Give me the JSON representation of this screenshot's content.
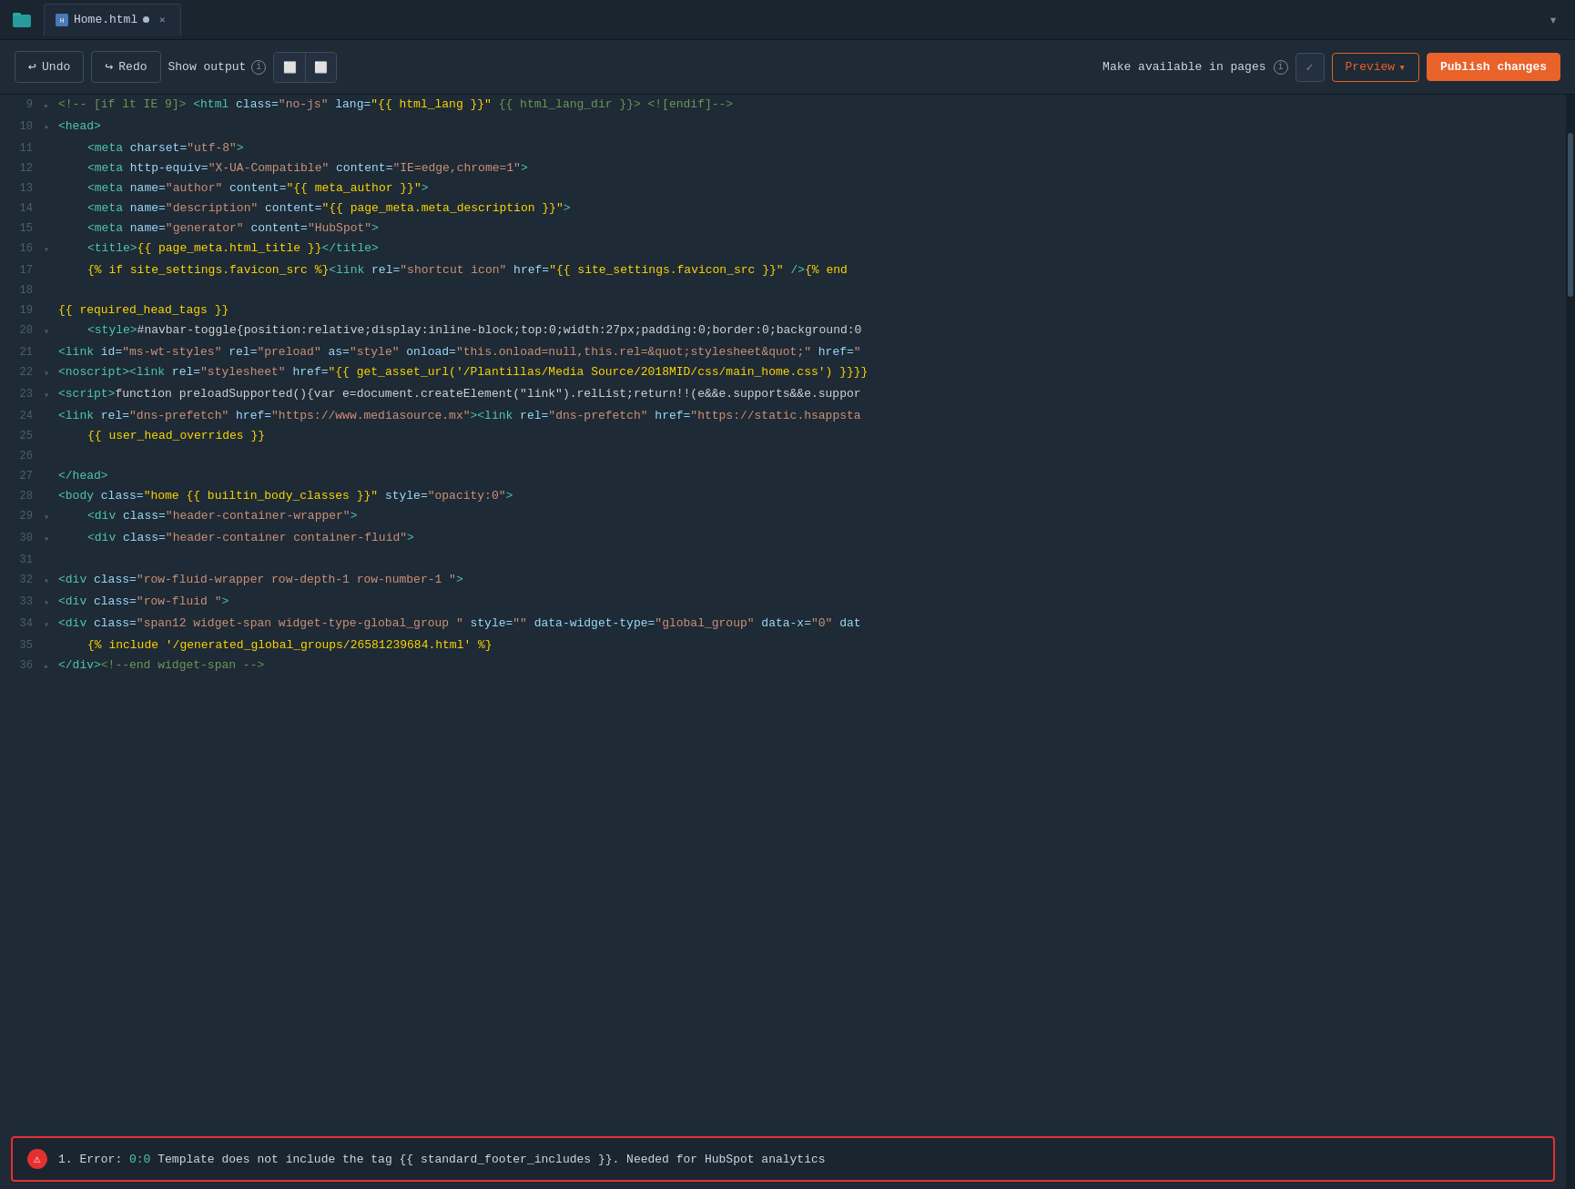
{
  "tabs": [
    {
      "label": "Home.html",
      "modified": true,
      "active": true,
      "icon": "file-icon"
    }
  ],
  "toolbar": {
    "undo_label": "Undo",
    "redo_label": "Redo",
    "show_output_label": "Show output",
    "make_available_label": "Make available in pages",
    "preview_label": "Preview",
    "publish_label": "Publish changes"
  },
  "code_lines": [
    {
      "num": "9",
      "indent": 0,
      "arrow": "▸",
      "content_parts": [
        {
          "text": "<!-- [if lt IE 9]>  ",
          "cls": "cmt"
        },
        {
          "text": "<html",
          "cls": "tag"
        },
        {
          "text": " class=",
          "cls": "attr"
        },
        {
          "text": "\"no-js\"",
          "cls": "str"
        },
        {
          "text": " lang=",
          "cls": "attr"
        },
        {
          "text": "\"{{ html_lang }}\"",
          "cls": "tpl"
        },
        {
          "text": " {{ html_lang_dir }}>  <![endif]-->",
          "cls": "cmt"
        }
      ]
    },
    {
      "num": "10",
      "indent": 0,
      "arrow": "▾",
      "content_parts": [
        {
          "text": "<head>",
          "cls": "tag"
        }
      ]
    },
    {
      "num": "11",
      "indent": 1,
      "arrow": "",
      "content_parts": [
        {
          "text": "<meta",
          "cls": "tag"
        },
        {
          "text": " charset=",
          "cls": "attr"
        },
        {
          "text": "\"utf-8\"",
          "cls": "str"
        },
        {
          "text": ">",
          "cls": "tag"
        }
      ]
    },
    {
      "num": "12",
      "indent": 1,
      "arrow": "",
      "content_parts": [
        {
          "text": "<meta",
          "cls": "tag"
        },
        {
          "text": " http-equiv=",
          "cls": "attr"
        },
        {
          "text": "\"X-UA-Compatible\"",
          "cls": "str"
        },
        {
          "text": " content=",
          "cls": "attr"
        },
        {
          "text": "\"IE=edge,chrome=1\"",
          "cls": "str"
        },
        {
          "text": ">",
          "cls": "tag"
        }
      ]
    },
    {
      "num": "13",
      "indent": 1,
      "arrow": "",
      "content_parts": [
        {
          "text": "<meta",
          "cls": "tag"
        },
        {
          "text": " name=",
          "cls": "attr"
        },
        {
          "text": "\"author\"",
          "cls": "str"
        },
        {
          "text": " content=",
          "cls": "attr"
        },
        {
          "text": "\"{{ meta_author }}\"",
          "cls": "tpl"
        },
        {
          "text": ">",
          "cls": "tag"
        }
      ]
    },
    {
      "num": "14",
      "indent": 1,
      "arrow": "",
      "content_parts": [
        {
          "text": "<meta",
          "cls": "tag"
        },
        {
          "text": " name=",
          "cls": "attr"
        },
        {
          "text": "\"description\"",
          "cls": "str"
        },
        {
          "text": " content=",
          "cls": "attr"
        },
        {
          "text": "\"{{ page_meta.meta_description }}\"",
          "cls": "tpl"
        },
        {
          "text": ">",
          "cls": "tag"
        }
      ]
    },
    {
      "num": "15",
      "indent": 1,
      "arrow": "",
      "content_parts": [
        {
          "text": "<meta",
          "cls": "tag"
        },
        {
          "text": " name=",
          "cls": "attr"
        },
        {
          "text": "\"generator\"",
          "cls": "str"
        },
        {
          "text": " content=",
          "cls": "attr"
        },
        {
          "text": "\"HubSpot\"",
          "cls": "str"
        },
        {
          "text": ">",
          "cls": "tag"
        }
      ]
    },
    {
      "num": "16",
      "indent": 1,
      "arrow": "▾",
      "content_parts": [
        {
          "text": "<title>",
          "cls": "tag"
        },
        {
          "text": "{{ page_meta.html_title }}",
          "cls": "tpl"
        },
        {
          "text": "</title>",
          "cls": "tag"
        }
      ]
    },
    {
      "num": "17",
      "indent": 1,
      "arrow": "",
      "content_parts": [
        {
          "text": "{% if site_settings.favicon_src %}",
          "cls": "tpl"
        },
        {
          "text": "<link",
          "cls": "tag"
        },
        {
          "text": " rel=",
          "cls": "attr"
        },
        {
          "text": "\"shortcut icon\"",
          "cls": "str"
        },
        {
          "text": " href=",
          "cls": "attr"
        },
        {
          "text": "\"{{ site_settings.favicon_src }}\"",
          "cls": "tpl"
        },
        {
          "text": " />",
          "cls": "tag"
        },
        {
          "text": "{% end",
          "cls": "tpl"
        }
      ]
    },
    {
      "num": "18",
      "indent": 0,
      "arrow": "",
      "content_parts": []
    },
    {
      "num": "19",
      "indent": 0,
      "arrow": "",
      "content_parts": [
        {
          "text": "{{ required_head_tags }}",
          "cls": "tpl"
        }
      ]
    },
    {
      "num": "20",
      "indent": 1,
      "arrow": "▾",
      "content_parts": [
        {
          "text": "<style>",
          "cls": "tag"
        },
        {
          "text": "#navbar-toggle{position:relative;display:inline-block;top:0;width:27px;padding:0;border:0;background:0",
          "cls": "op"
        }
      ]
    },
    {
      "num": "21",
      "indent": 0,
      "arrow": "",
      "content_parts": [
        {
          "text": "<link",
          "cls": "tag"
        },
        {
          "text": " id=",
          "cls": "attr"
        },
        {
          "text": "\"ms-wt-styles\"",
          "cls": "str"
        },
        {
          "text": " rel=",
          "cls": "attr"
        },
        {
          "text": "\"preload\"",
          "cls": "str"
        },
        {
          "text": " as=",
          "cls": "attr"
        },
        {
          "text": "\"style\"",
          "cls": "str"
        },
        {
          "text": " onload=",
          "cls": "attr"
        },
        {
          "text": "\"this.onload=null,this.rel=&quot;stylesheet&quot;\"",
          "cls": "str"
        },
        {
          "text": " href=",
          "cls": "attr"
        },
        {
          "text": "\"",
          "cls": "str"
        }
      ]
    },
    {
      "num": "22",
      "indent": 0,
      "arrow": "▾",
      "content_parts": [
        {
          "text": "<noscript>",
          "cls": "tag"
        },
        {
          "text": "<link",
          "cls": "tag"
        },
        {
          "text": " rel=",
          "cls": "attr"
        },
        {
          "text": "\"stylesheet\"",
          "cls": "str"
        },
        {
          "text": " href=",
          "cls": "attr"
        },
        {
          "text": "\"{{ get_asset_url('/Plantillas/Media Source/2018MID/css/main_home.css') }}",
          "cls": "tpl"
        },
        {
          "text": "}}",
          "cls": "tpl"
        }
      ]
    },
    {
      "num": "23",
      "indent": 0,
      "arrow": "▾",
      "content_parts": [
        {
          "text": "<script>",
          "cls": "tag"
        },
        {
          "text": "function preloadSupported(){var e=document.createElement(\"link\").relList;return!!(e&&e.supports&&e.suppor",
          "cls": "op"
        }
      ]
    },
    {
      "num": "24",
      "indent": 0,
      "arrow": "",
      "content_parts": [
        {
          "text": "<link",
          "cls": "tag"
        },
        {
          "text": " rel=",
          "cls": "attr"
        },
        {
          "text": "\"dns-prefetch\"",
          "cls": "str"
        },
        {
          "text": " href=",
          "cls": "attr"
        },
        {
          "text": "\"https://www.mediasource.mx\"",
          "cls": "str"
        },
        {
          "text": "><link",
          "cls": "tag"
        },
        {
          "text": " rel=",
          "cls": "attr"
        },
        {
          "text": "\"dns-prefetch\"",
          "cls": "str"
        },
        {
          "text": " href=",
          "cls": "attr"
        },
        {
          "text": "\"https://static.hsappsta",
          "cls": "str"
        }
      ]
    },
    {
      "num": "25",
      "indent": 1,
      "arrow": "",
      "content_parts": [
        {
          "text": "{{ user_head_overrides }}",
          "cls": "tpl"
        }
      ]
    },
    {
      "num": "26",
      "indent": 0,
      "arrow": "",
      "content_parts": []
    },
    {
      "num": "27",
      "indent": 0,
      "arrow": "",
      "content_parts": [
        {
          "text": "</head>",
          "cls": "tag"
        }
      ]
    },
    {
      "num": "28",
      "indent": 0,
      "arrow": "",
      "content_parts": [
        {
          "text": "<body",
          "cls": "tag"
        },
        {
          "text": " class=",
          "cls": "attr"
        },
        {
          "text": "\"home {{ builtin_body_classes }}\"",
          "cls": "tpl"
        },
        {
          "text": " style=",
          "cls": "attr"
        },
        {
          "text": "\"opacity:0\"",
          "cls": "str"
        },
        {
          "text": ">",
          "cls": "tag"
        }
      ]
    },
    {
      "num": "29",
      "indent": 1,
      "arrow": "▾",
      "content_parts": [
        {
          "text": "<div",
          "cls": "tag"
        },
        {
          "text": " class=",
          "cls": "attr"
        },
        {
          "text": "\"header-container-wrapper\"",
          "cls": "str"
        },
        {
          "text": ">",
          "cls": "tag"
        }
      ]
    },
    {
      "num": "30",
      "indent": 1,
      "arrow": "▾",
      "content_parts": [
        {
          "text": "<div",
          "cls": "tag"
        },
        {
          "text": " class=",
          "cls": "attr"
        },
        {
          "text": "\"header-container container-fluid\"",
          "cls": "str"
        },
        {
          "text": ">",
          "cls": "tag"
        }
      ]
    },
    {
      "num": "31",
      "indent": 0,
      "arrow": "",
      "content_parts": []
    },
    {
      "num": "32",
      "indent": 0,
      "arrow": "▾",
      "content_parts": [
        {
          "text": "<div",
          "cls": "tag"
        },
        {
          "text": " class=",
          "cls": "attr"
        },
        {
          "text": "\"row-fluid-wrapper row-depth-1 row-number-1 \"",
          "cls": "str"
        },
        {
          "text": ">",
          "cls": "tag"
        }
      ]
    },
    {
      "num": "33",
      "indent": 0,
      "arrow": "▾",
      "content_parts": [
        {
          "text": "<div",
          "cls": "tag"
        },
        {
          "text": " class=",
          "cls": "attr"
        },
        {
          "text": "\"row-fluid \"",
          "cls": "str"
        },
        {
          "text": ">",
          "cls": "tag"
        }
      ]
    },
    {
      "num": "34",
      "indent": 0,
      "arrow": "▾",
      "content_parts": [
        {
          "text": "<div",
          "cls": "tag"
        },
        {
          "text": " class=",
          "cls": "attr"
        },
        {
          "text": "\"span12 widget-span widget-type-global_group \"",
          "cls": "str"
        },
        {
          "text": " style=",
          "cls": "attr"
        },
        {
          "text": "\"\"",
          "cls": "str"
        },
        {
          "text": " data-widget-type=",
          "cls": "attr"
        },
        {
          "text": "\"global_group\"",
          "cls": "str"
        },
        {
          "text": " data-x=",
          "cls": "attr"
        },
        {
          "text": "\"0\"",
          "cls": "str"
        },
        {
          "text": " dat",
          "cls": "attr"
        }
      ]
    },
    {
      "num": "35",
      "indent": 1,
      "arrow": "",
      "content_parts": [
        {
          "text": "{% include '/generated_global_groups/26581239684.html' %}",
          "cls": "tpl"
        }
      ]
    },
    {
      "num": "36",
      "indent": 0,
      "arrow": "▸",
      "content_parts": [
        {
          "text": "</div>",
          "cls": "tag"
        },
        {
          "text": "<!--end widget-span -->",
          "cls": "cmt"
        }
      ]
    }
  ],
  "error": {
    "number": "1.",
    "label": "Error:",
    "location": "0:0",
    "message": "Template does not include the tag {{ standard_footer_includes }}. Needed for HubSpot analytics"
  },
  "colors": {
    "bg_editor": "#1e2a35",
    "bg_tab_active": "#1e2a38",
    "accent_orange": "#e8622a",
    "error_red": "#e53030",
    "tpl_color": "#ffd700",
    "tag_color": "#4ec9b0",
    "attr_color": "#9cdcfe",
    "str_color": "#ce9178"
  }
}
